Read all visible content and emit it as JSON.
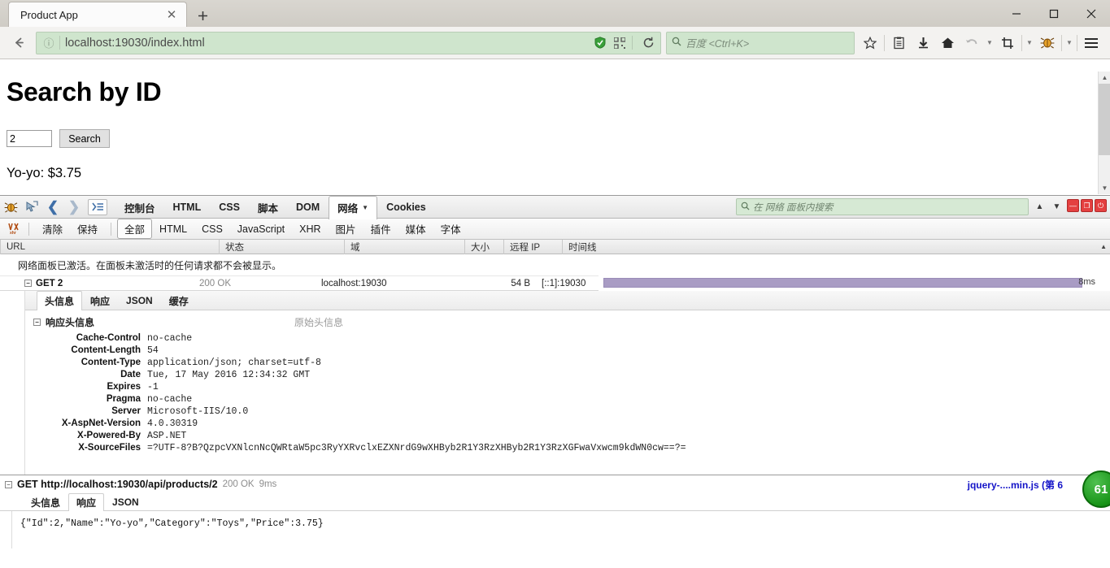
{
  "browser": {
    "tab": {
      "title": "Product App",
      "close_label": "✕"
    },
    "new_tab_label": "✚",
    "window_controls": {
      "minimize": "—",
      "maximize": "▢",
      "close": "✕"
    },
    "nav": {
      "back": "←",
      "forward": "→"
    },
    "url": {
      "text": "localhost:19030/index.html",
      "info_icon": "ⓘ"
    },
    "url_right_icons": [
      "shield-icon",
      "qrcode-icon",
      "reload-icon"
    ],
    "search": {
      "placeholder": "百度 <Ctrl+K>",
      "icon": "search-icon"
    },
    "toolbar_icons": [
      "bookmark-star-icon",
      "library-icon",
      "download-icon",
      "home-icon",
      "undo-icon",
      "screenshot-icon",
      "firebug-icon",
      "menu-icon"
    ]
  },
  "page": {
    "heading": "Search by ID",
    "input_value": "2",
    "input_placeholder": "",
    "search_button": "Search",
    "result": "Yo-yo: $3.75"
  },
  "firebug": {
    "toolbar": {
      "inspect_icon": "inspect-icon",
      "back_arrow": "❮",
      "forward_arrow": "❯",
      "console_toggle": "❯☰",
      "panels": [
        {
          "label": "控制台",
          "active": false,
          "has_menu": false
        },
        {
          "label": "HTML",
          "active": false,
          "has_menu": false
        },
        {
          "label": "CSS",
          "active": false,
          "has_menu": false
        },
        {
          "label": "脚本",
          "active": false,
          "has_menu": false
        },
        {
          "label": "DOM",
          "active": false,
          "has_menu": false
        },
        {
          "label": "网络",
          "active": true,
          "has_menu": true
        },
        {
          "label": "Cookies",
          "active": false,
          "has_menu": false
        }
      ],
      "search_placeholder": "在 网络 面板内搜索",
      "prev_arrow": "⌃",
      "next_arrow": "⌄",
      "win_minimize": "—",
      "win_restore": "❐",
      "win_close": "⏻"
    },
    "filters": {
      "xhr_icon": "xhr-icon",
      "items": [
        {
          "label": "清除",
          "selected": false
        },
        {
          "label": "保持",
          "selected": false
        },
        {
          "label": "全部",
          "selected": true
        },
        {
          "label": "HTML",
          "selected": false
        },
        {
          "label": "CSS",
          "selected": false
        },
        {
          "label": "JavaScript",
          "selected": false
        },
        {
          "label": "XHR",
          "selected": false
        },
        {
          "label": "图片",
          "selected": false
        },
        {
          "label": "插件",
          "selected": false
        },
        {
          "label": "媒体",
          "selected": false
        },
        {
          "label": "字体",
          "selected": false
        }
      ]
    },
    "table": {
      "columns": [
        "URL",
        "状态",
        "域",
        "大小",
        "远程 IP",
        "时间线"
      ],
      "notice": "网络面板已激活。在面板未激活时的任何请求都不会被显示。",
      "row": {
        "twisty": "−",
        "url": "GET 2",
        "status": "200 OK",
        "domain": "localhost:19030",
        "size": "54 B",
        "remote_ip": "[::1]:19030",
        "time": "8ms",
        "bar_color": "#a99cc4"
      }
    },
    "detail": {
      "tabs": [
        {
          "label": "头信息",
          "active": true
        },
        {
          "label": "响应",
          "active": false
        },
        {
          "label": "JSON",
          "active": false
        },
        {
          "label": "缓存",
          "active": false
        }
      ],
      "group_twisty": "−",
      "group_title": "响应头信息",
      "raw_link": "原始头信息",
      "headers": [
        {
          "name": "Cache-Control",
          "value": "no-cache"
        },
        {
          "name": "Content-Length",
          "value": "54"
        },
        {
          "name": "Content-Type",
          "value": "application/json; charset=utf-8"
        },
        {
          "name": "Date",
          "value": "Tue, 17 May 2016 12:34:32 GMT"
        },
        {
          "name": "Expires",
          "value": "-1"
        },
        {
          "name": "Pragma",
          "value": "no-cache"
        },
        {
          "name": "Server",
          "value": "Microsoft-IIS/10.0"
        },
        {
          "name": "X-AspNet-Version",
          "value": "4.0.30319"
        },
        {
          "name": "X-Powered-By",
          "value": "ASP.NET"
        },
        {
          "name": "X-SourceFiles",
          "value": "=?UTF-8?B?QzpcVXNlcnNcQWRtaW5pc3RyYXRvclxEZXNrdG9wXHByb2R1Y3RzXHByb2R1Y3RzXGFwaVxwcm9kdWN0cw==?="
        }
      ]
    },
    "console": {
      "twisty": "−",
      "request_title": "GET http://localhost:19030/api/products/2",
      "status": "200 OK",
      "time": "9ms",
      "source": "jquery-....min.js (第 6",
      "badge": "61",
      "tabs": [
        {
          "label": "头信息",
          "active": false
        },
        {
          "label": "响应",
          "active": true
        },
        {
          "label": "JSON",
          "active": false
        }
      ],
      "response_body": "{\"Id\":2,\"Name\":\"Yo-yo\",\"Category\":\"Toys\",\"Price\":3.75}"
    }
  }
}
